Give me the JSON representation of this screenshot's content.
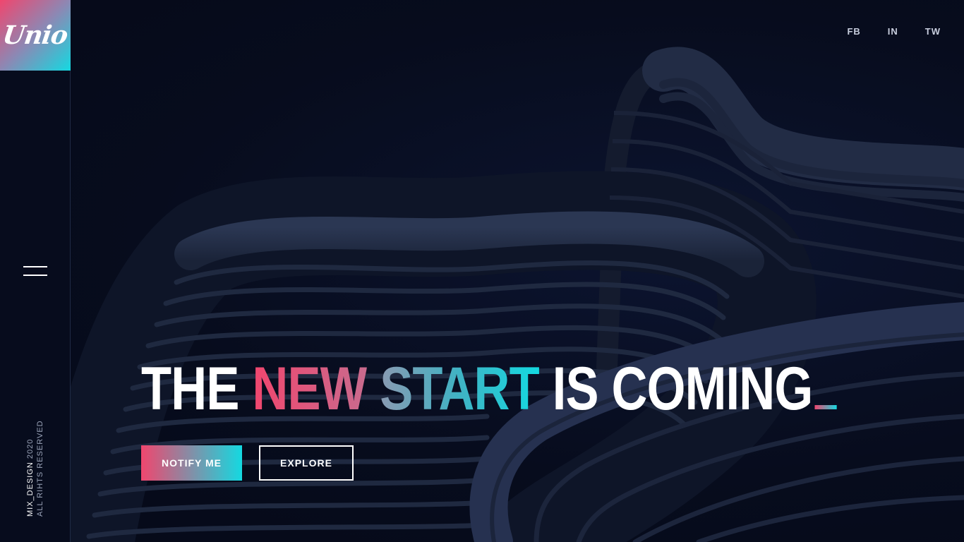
{
  "brand": {
    "logo_text": "Unio",
    "colors": {
      "accent_start": "#f0466e",
      "accent_end": "#14d9e1",
      "background": "#070c1d"
    }
  },
  "sidebar": {
    "menu_icon": "hamburger-menu-icon",
    "copyright_brand": "MIX_DESIGN",
    "copyright_year": "2020",
    "copyright_text": "ALL RIHTS RESERVED"
  },
  "social": {
    "links": [
      {
        "label": "FB"
      },
      {
        "label": "IN"
      },
      {
        "label": "TW"
      }
    ]
  },
  "hero": {
    "headline_part1": "THE",
    "headline_part2": "NEW",
    "headline_part3": "START",
    "headline_part4": "IS COMING",
    "primary_button": "NOTIFY ME",
    "secondary_button": "EXPLORE"
  }
}
